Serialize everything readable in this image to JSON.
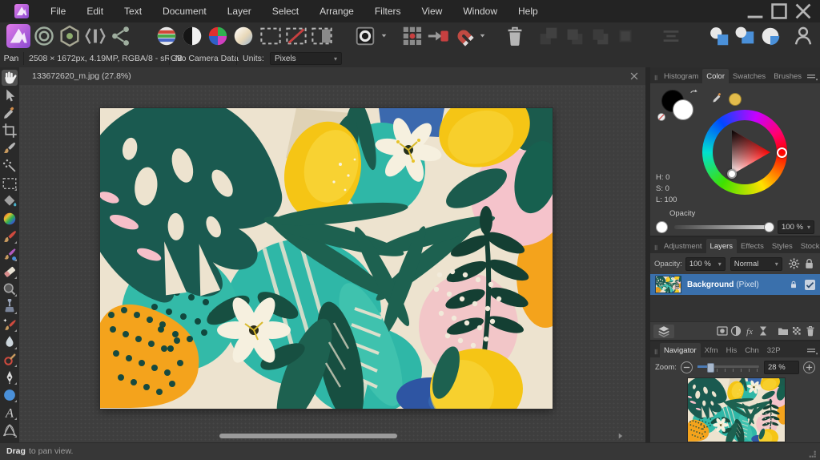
{
  "menubar": {
    "items": [
      {
        "label": "File",
        "name": "menu-file"
      },
      {
        "label": "Edit",
        "name": "menu-edit"
      },
      {
        "label": "Text",
        "name": "menu-text"
      },
      {
        "label": "Document",
        "name": "menu-document"
      },
      {
        "label": "Layer",
        "name": "menu-layer"
      },
      {
        "label": "Select",
        "name": "menu-select"
      },
      {
        "label": "Arrange",
        "name": "menu-arrange"
      },
      {
        "label": "Filters",
        "name": "menu-filters"
      },
      {
        "label": "View",
        "name": "menu-view"
      },
      {
        "label": "Window",
        "name": "menu-window"
      },
      {
        "label": "Help",
        "name": "menu-help"
      }
    ]
  },
  "window_controls": [
    {
      "name": "minimize-button",
      "icon": "minimize-icon"
    },
    {
      "name": "maximize-button",
      "icon": "maximize-icon"
    },
    {
      "name": "close-button",
      "icon": "close-icon"
    }
  ],
  "toolbar": {
    "personas": [
      {
        "name": "photo-persona-button",
        "icon": "applogo-icon",
        "active": true
      },
      {
        "name": "liquify-persona-button",
        "icon": "liquify-icon"
      },
      {
        "name": "develop-persona-button",
        "icon": "develop-icon"
      },
      {
        "name": "tone-mapping-persona-button",
        "icon": "tonemap-icon"
      },
      {
        "name": "export-persona-button",
        "icon": "share-icon"
      }
    ],
    "auto_adjustments": [
      {
        "name": "auto-colours-button",
        "icon": "autocolour-icon"
      },
      {
        "name": "auto-levels-button",
        "icon": "autolevels-icon"
      },
      {
        "name": "auto-contrast-button",
        "icon": "autocontrast-icon"
      },
      {
        "name": "auto-white-balance-button",
        "icon": "autowb-icon"
      }
    ],
    "selection": [
      {
        "name": "select-all-button",
        "icon": "marquee-icon"
      },
      {
        "name": "deselect-button",
        "icon": "deselect-icon"
      },
      {
        "name": "invert-selection-button",
        "icon": "invertsel-icon"
      }
    ],
    "quick_mask": [
      {
        "name": "quick-mask-button",
        "icon": "quickmask-icon"
      },
      {
        "name": "quick-mask-dropdown",
        "icon": "caret-icon",
        "caret": true
      }
    ],
    "snapping": [
      {
        "name": "snapping-grid-button",
        "icon": "snapgrid-icon"
      },
      {
        "name": "force-pixel-alignment-button",
        "icon": "snapmove-icon"
      },
      {
        "name": "snapping-button",
        "icon": "magnet-icon"
      },
      {
        "name": "snapping-dropdown",
        "icon": "caret-icon",
        "caret": true
      }
    ],
    "delete": [
      {
        "name": "delete-button",
        "icon": "trash-icon"
      }
    ],
    "arrange": [
      {
        "name": "move-to-front-button",
        "icon": "arrfront-icon",
        "disabled": true
      },
      {
        "name": "move-forward-button",
        "icon": "arrfwd-icon",
        "disabled": true
      },
      {
        "name": "move-backward-button",
        "icon": "arrback-icon",
        "disabled": true
      },
      {
        "name": "move-to-back-button",
        "icon": "arrlast-icon",
        "disabled": true
      }
    ],
    "alignment": [
      {
        "name": "alignment-button",
        "icon": "align-icon",
        "disabled": true
      }
    ],
    "assistant": [
      {
        "name": "insert-over-button",
        "icon": "insertover-icon"
      },
      {
        "name": "insert-inside-button",
        "icon": "insertinside-icon"
      },
      {
        "name": "insert-behind-button",
        "icon": "insertbehind-icon"
      }
    ],
    "account": [
      {
        "name": "account-button",
        "icon": "user-icon"
      }
    ]
  },
  "context_toolbar": {
    "tool_label": "Pan",
    "document_info": "2508 × 1672px, 4.19MP, RGBA/8 - sRGB",
    "camera_info": "No Camera Data",
    "units_label": "Units:",
    "units_value": "Pixels"
  },
  "document_tab": {
    "title": "133672620_m.jpg (27.8%)"
  },
  "tools": [
    {
      "name": "view-tool",
      "icon": "hand-icon",
      "active": true
    },
    {
      "name": "move-tool",
      "icon": "move-icon"
    },
    {
      "name": "colour-picker-tool",
      "icon": "picker-icon"
    },
    {
      "name": "crop-tool",
      "icon": "crop-icon"
    },
    {
      "name": "selection-brush-tool",
      "icon": "selbrush-icon"
    },
    {
      "name": "flood-select-tool",
      "icon": "wand-icon"
    },
    {
      "name": "marquee-tool",
      "icon": "marquee-icon",
      "flyout": true
    },
    {
      "name": "flood-fill-tool",
      "icon": "bucket-icon"
    },
    {
      "name": "gradient-tool",
      "icon": "rainbow-icon"
    },
    {
      "name": "paint-brush-tool",
      "icon": "brush-icon",
      "flyout": true
    },
    {
      "name": "colour-replacement-brush-tool",
      "icon": "brushdot-icon",
      "flyout": true
    },
    {
      "name": "erase-brush-tool",
      "icon": "eraser-icon",
      "flyout": true
    },
    {
      "name": "zoom-tool",
      "icon": "magnify-icon",
      "flyout": true
    },
    {
      "name": "clone-brush-tool",
      "icon": "stamp-icon",
      "flyout": true
    },
    {
      "name": "healing-brush-tool",
      "icon": "heal-icon",
      "flyout": true
    },
    {
      "name": "blur-brush-tool",
      "icon": "drop-icon",
      "flyout": true
    },
    {
      "name": "smudge-brush-tool",
      "icon": "smudge-icon",
      "flyout": true
    },
    {
      "name": "pen-tool",
      "icon": "pen-icon",
      "flyout": true
    },
    {
      "name": "ellipse-tool",
      "icon": "bluecircle-icon",
      "flyout": true
    },
    {
      "name": "text-tool",
      "icon": "textA-icon",
      "flyout": true
    },
    {
      "name": "mesh-warp-tool",
      "icon": "mesh-icon",
      "flyout": true
    }
  ],
  "color_panel": {
    "tabs": [
      {
        "label": "Histogram",
        "name": "tab-histogram"
      },
      {
        "label": "Color",
        "name": "tab-color",
        "active": true
      },
      {
        "label": "Swatches",
        "name": "tab-swatches"
      },
      {
        "label": "Brushes",
        "name": "tab-brushes"
      }
    ],
    "hsl": {
      "h": "H: 0",
      "s": "S: 0",
      "l": "L: 100"
    },
    "opacity_label": "Opacity",
    "opacity_value": "100 %"
  },
  "layers_panel": {
    "tabs": [
      {
        "label": "Adjustment",
        "name": "tab-adjustment"
      },
      {
        "label": "Layers",
        "name": "tab-layers",
        "active": true
      },
      {
        "label": "Effects",
        "name": "tab-effects"
      },
      {
        "label": "Styles",
        "name": "tab-styles"
      },
      {
        "label": "Stock",
        "name": "tab-stock"
      }
    ],
    "opacity_label": "Opacity:",
    "opacity_value": "100 %",
    "blend_mode": "Normal",
    "layer": {
      "name": "Background",
      "type": "(Pixel)"
    }
  },
  "navigator_panel": {
    "tabs": [
      {
        "label": "Navigator",
        "name": "tab-navigator",
        "active": true
      },
      {
        "label": "Xfm",
        "name": "tab-xfm"
      },
      {
        "label": "His",
        "name": "tab-his"
      },
      {
        "label": "Chn",
        "name": "tab-chn"
      },
      {
        "label": "32P",
        "name": "tab-32p"
      }
    ],
    "zoom_label": "Zoom:",
    "zoom_value": "28 %"
  },
  "statusbar": {
    "action": "Drag",
    "hint": "to pan view."
  }
}
